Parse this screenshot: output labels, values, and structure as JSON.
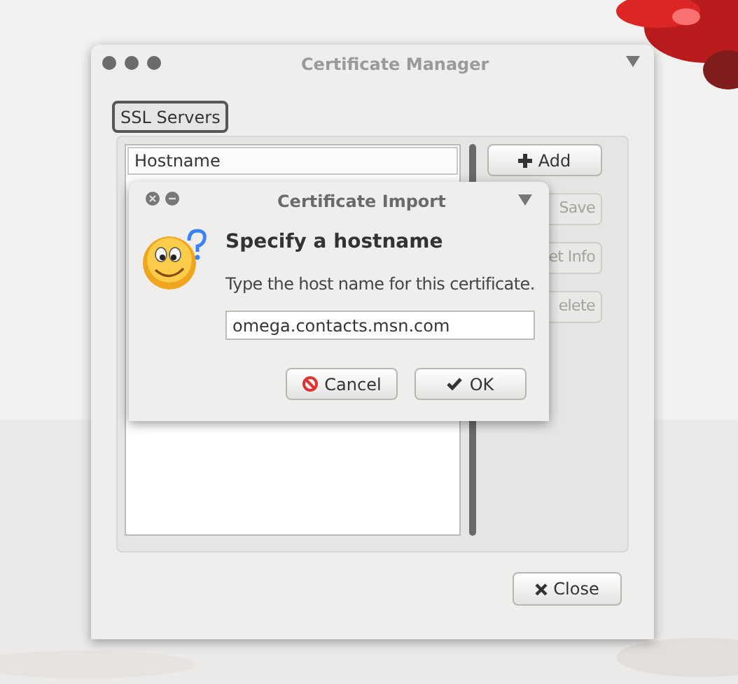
{
  "main_window": {
    "title": "Certificate Manager",
    "tabs": [
      {
        "label": "SSL Servers",
        "selected": true
      }
    ],
    "list": {
      "header": "Hostname"
    },
    "buttons": [
      {
        "label": "Add",
        "kind": "add"
      },
      {
        "label": "Save",
        "kind": "covered"
      },
      {
        "label": "et Info",
        "kind": "covered"
      },
      {
        "label": "elete",
        "kind": "covered"
      }
    ],
    "close_button": "Close"
  },
  "dialog": {
    "title": "Certificate Import",
    "heading": "Specify a hostname",
    "message": "Type the host name for this certificate.",
    "input": {
      "value": "omega.contacts.msn.com"
    },
    "buttons": [
      {
        "label": "Cancel",
        "kind": "cancel"
      },
      {
        "label": "OK",
        "kind": "ok"
      }
    ]
  }
}
